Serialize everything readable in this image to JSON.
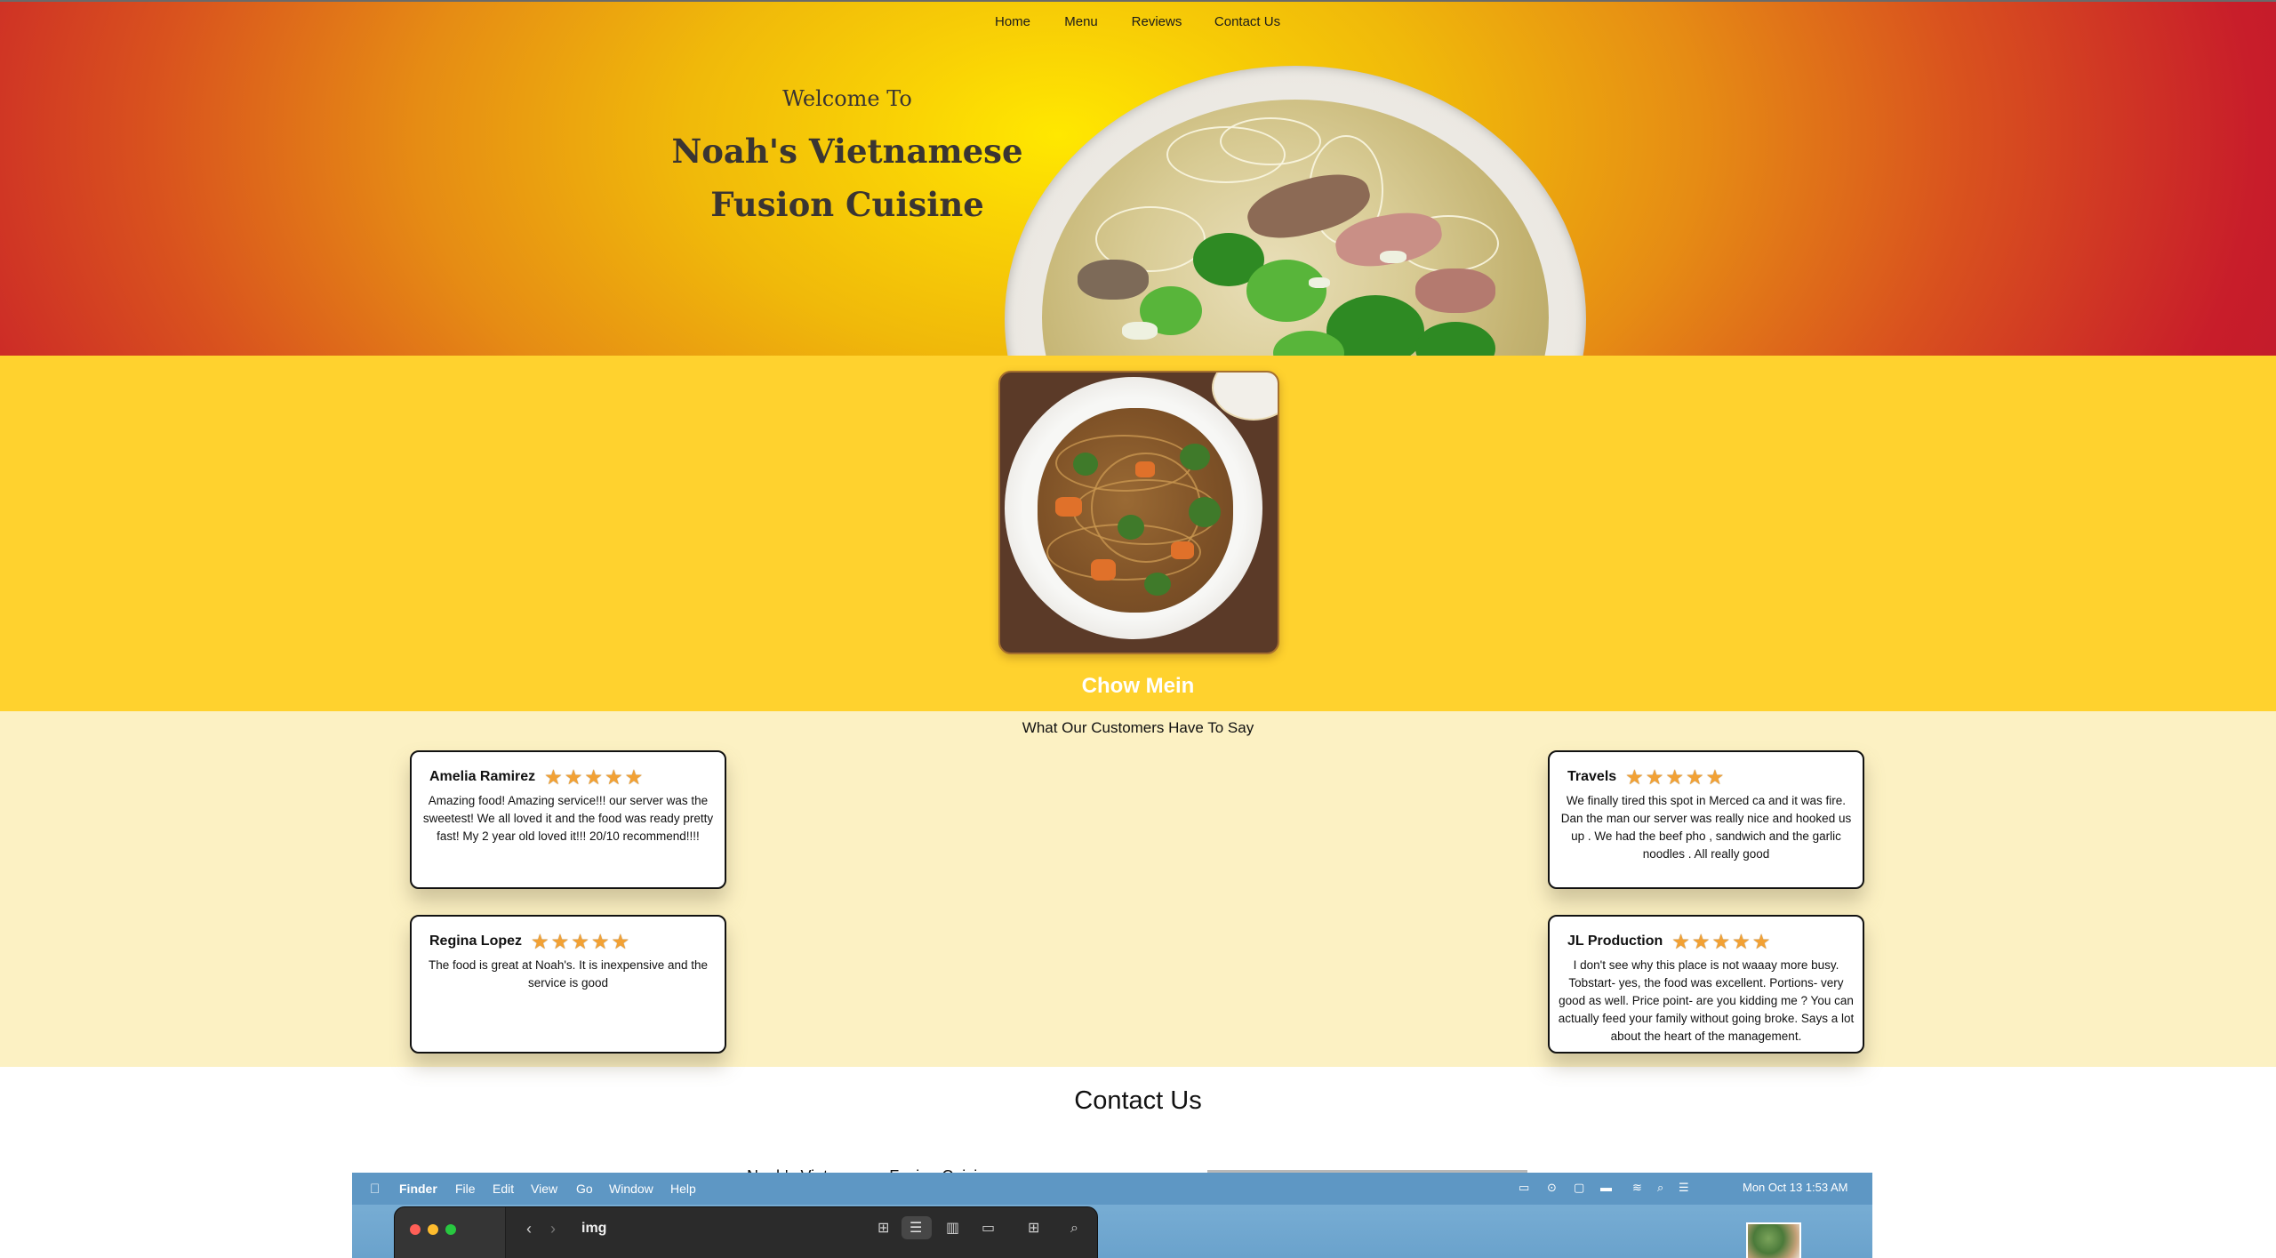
{
  "nav": {
    "items": [
      "Home",
      "Menu",
      "Reviews",
      "Contact Us"
    ]
  },
  "hero": {
    "welcome": "Welcome To",
    "name": "Noah's Vietnamese Fusion Cuisine",
    "image_icon": "pho-bowl-photo"
  },
  "featured": {
    "dish_name": "Chow Mein",
    "image_icon": "chow-mein-photo",
    "slider_prev_icon": "chevron-left-icon"
  },
  "reviews": {
    "heading": "What Our Customers Have To Say",
    "rating_icon": "star-icon",
    "items": [
      {
        "name": "Amelia Ramirez",
        "stars": 5,
        "text": "Amazing food! Amazing service!!! our server was the sweetest! We all loved it and the food was ready pretty fast! My 2 year old loved it!!! 20/10 recommend!!!!"
      },
      {
        "name": "Travels",
        "stars": 5,
        "text": "We finally tired this spot in Merced ca and it was fire. Dan the man our server was really nice and hooked us up . We had the beef pho , sandwich and the garlic noodles . All really good"
      },
      {
        "name": "Regina Lopez",
        "stars": 5,
        "text": "The food is great at Noah's. It is inexpensive and the service is good"
      },
      {
        "name": "JL Production",
        "stars": 5,
        "text": "I don't see why this place is not waaay more busy. Tobstart- yes, the food was excellent. Portions- very good as well. Price point- are you kidding me ? You can actually feed your family without going broke. Says a lot about the heart of the management."
      }
    ]
  },
  "contact": {
    "title": "Contact Us",
    "peek_text": "Noah's Vietnamese Fusion Cuisine"
  },
  "desktop": {
    "menubar": {
      "apple_icon": "apple-logo-icon",
      "app": "Finder",
      "menus": [
        "File",
        "Edit",
        "View",
        "Go",
        "Window",
        "Help"
      ],
      "datetime": "Mon Oct 13  1:53 AM",
      "status_icons": [
        "screen-mirroring-icon",
        "play-icon",
        "display-icon",
        "battery-icon",
        "wifi-icon",
        "search-icon",
        "control-center-icon"
      ]
    },
    "finder": {
      "title": "img",
      "toolbar_icons": [
        "grid-view-icon",
        "list-view-icon",
        "column-view-icon",
        "gallery-view-icon",
        "group-icon",
        "share-icon",
        "tag-icon",
        "more-icon",
        "search-icon"
      ],
      "accent_red": "#ff5f57",
      "accent_yellow": "#febc2e",
      "accent_green": "#28c840"
    }
  },
  "colors": {
    "featured_bg": "#ffd22e",
    "reviews_bg": "#fcf1c3",
    "star": "#f2a134"
  }
}
